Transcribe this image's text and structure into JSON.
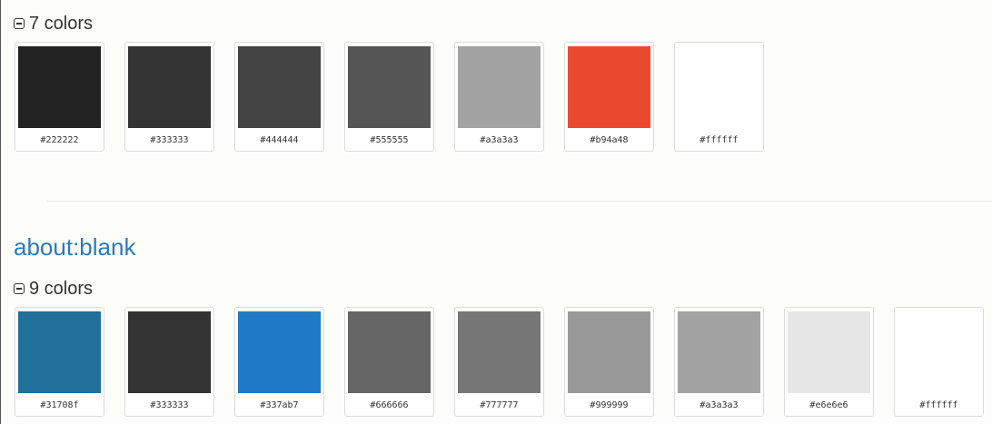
{
  "groups": [
    {
      "count_label": "7 colors",
      "colors": [
        "#222222",
        "#333333",
        "#444444",
        "#555555",
        "#a3a3a3",
        "#b94a48",
        "#ffffff"
      ],
      "swatch_fill": [
        "#222222",
        "#333333",
        "#444444",
        "#555555",
        "#a3a3a3",
        "#e94a30",
        "#ffffff"
      ]
    },
    {
      "site": "about:blank",
      "count_label": "9 colors",
      "colors": [
        "#31708f",
        "#333333",
        "#337ab7",
        "#666666",
        "#777777",
        "#999999",
        "#a3a3a3",
        "#e6e6e6",
        "#ffffff"
      ],
      "swatch_fill": [
        "#1f709a",
        "#333333",
        "#2079c6",
        "#666666",
        "#777777",
        "#999999",
        "#a3a3a3",
        "#e6e6e6",
        "#ffffff"
      ]
    }
  ]
}
